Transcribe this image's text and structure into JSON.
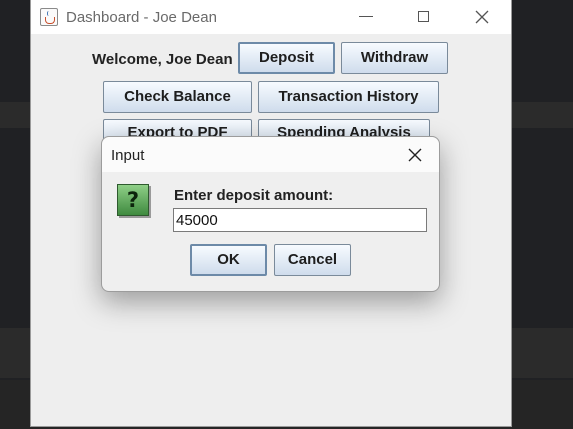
{
  "window": {
    "title": "Dashboard - Joe Dean",
    "welcome_label": "Welcome, Joe Dean",
    "buttons": {
      "deposit": "Deposit",
      "withdraw": "Withdraw",
      "check_balance": "Check Balance",
      "transaction_history": "Transaction History",
      "export_pdf": "Export to PDF",
      "spending_analysis": "Spending Analysis"
    }
  },
  "dialog": {
    "title": "Input",
    "prompt": "Enter deposit amount:",
    "input_value": "45000",
    "ok_label": "OK",
    "cancel_label": "Cancel",
    "icon": "question-icon"
  },
  "colors": {
    "button_gradient_top": "#f7fbff",
    "button_gradient_bottom": "#cfdcec",
    "question_icon": "#4f9e4a"
  }
}
